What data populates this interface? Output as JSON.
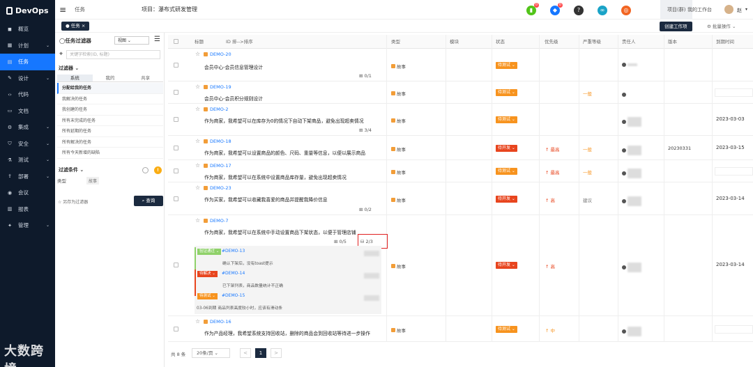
{
  "app": {
    "logo_text": "DevOps"
  },
  "nav": {
    "items": [
      {
        "label": "概览",
        "icon": "dashboard-icon",
        "chev": ""
      },
      {
        "label": "计划",
        "icon": "calendar-icon",
        "chev": "⌄"
      },
      {
        "label": "任务",
        "icon": "task-icon",
        "chev": ""
      },
      {
        "label": "设计",
        "icon": "design-icon",
        "chev": "⌄"
      },
      {
        "label": "代码",
        "icon": "code-icon",
        "chev": ""
      },
      {
        "label": "文档",
        "icon": "document-icon",
        "chev": ""
      },
      {
        "label": "集成",
        "icon": "integration-icon",
        "chev": "⌄"
      },
      {
        "label": "安全",
        "icon": "security-icon",
        "chev": "⌄"
      },
      {
        "label": "测试",
        "icon": "test-icon",
        "chev": "⌄"
      },
      {
        "label": "部署",
        "icon": "deploy-icon",
        "chev": "⌄"
      },
      {
        "label": "会议",
        "icon": "meeting-icon",
        "chev": ""
      },
      {
        "label": "报表",
        "icon": "report-icon",
        "chev": ""
      },
      {
        "label": "管理",
        "icon": "settings-icon",
        "chev": "⌄"
      }
    ],
    "active_index": 2
  },
  "watermark": "大数跨境",
  "topbar": {
    "menu_label": "任务",
    "project_label": "项目：瀑布式研发管理",
    "badge_green": "0",
    "badge_blue": "0",
    "tab_project": "项目(群)",
    "tab_workbench": "我的工作台",
    "user_name": "赵"
  },
  "subbar": {
    "chip_label": "任务",
    "create_label": "创建工作项",
    "batch_label": "批量操作"
  },
  "filter": {
    "title": "任务过滤器",
    "view_label": "视图",
    "search_placeholder": "关键字检索(ID, 标题)",
    "filter_header": "过滤器",
    "tabs": [
      "系统",
      "我的",
      "共享"
    ],
    "list": [
      "分配给我的任务",
      "我解决的任务",
      "我创建的任务",
      "所有未完成的任务",
      "所有延期的任务",
      "所有解决的任务",
      "所有今天新增的缺陷"
    ],
    "cond_label": "过滤条件",
    "type_label": "类型",
    "type_value": "故事",
    "save_label": "另存为过滤器",
    "query_label": "查询"
  },
  "table": {
    "headers": {
      "title": "标题",
      "sort": "ID 排-->排序",
      "type": "类型",
      "module": "模块",
      "status": "状态",
      "priority": "优先级",
      "severity": "严重等级",
      "assignee": "责任人",
      "version": "版本",
      "deadline": "到期时间"
    },
    "rows": [
      {
        "key": "DEMO-20",
        "title": "会员中心-会员信息管理设计",
        "type": "故事",
        "status": "待测试",
        "status_color": "orange",
        "priority": "",
        "severity": "",
        "version": "",
        "date": "",
        "sub": "0/1"
      },
      {
        "key": "DEMO-19",
        "title": "会员中心-会员积分规则设计",
        "type": "故事",
        "status": "待测试",
        "status_color": "orange",
        "priority": "",
        "severity": "一般",
        "version": "",
        "date": ""
      },
      {
        "key": "DEMO-2",
        "title": "作为商家，我希望可以在库存为0的情况下自动下架商品，避免出现超卖情况",
        "type": "故事",
        "status": "待测试",
        "status_color": "orange",
        "priority": "",
        "severity": "",
        "version": "",
        "date": "2023-03-03",
        "sub": "3/4"
      },
      {
        "key": "DEMO-18",
        "title": "作为商家，我希望可以设置商品的颜色、尺码、重量等信息，以便以展示商品",
        "type": "故事",
        "status": "待开发",
        "status_color": "red",
        "priority": "最高",
        "severity": "一般",
        "version": "20230331",
        "date": "2023-03-15"
      },
      {
        "key": "DEMO-17",
        "title": "作为商家，我希望可以在系统中设置商品库存量，避免出现超卖情况",
        "type": "故事",
        "status": "待测试",
        "status_color": "orange",
        "priority": "最高",
        "severity": "一般",
        "version": "",
        "date": ""
      },
      {
        "key": "DEMO-23",
        "title": "作为买家，我希望可以收藏我喜爱的商品并提醒我降价信息",
        "type": "故事",
        "status": "待开发",
        "status_color": "red",
        "priority": "高",
        "severity": "建议",
        "version": "",
        "date": "2023-03-14",
        "sub": "0/2"
      },
      {
        "key": "DEMO-7",
        "title": "作为商家，我希望可以在系统中手动设置商品下架状态，以便于管理店铺",
        "type": "故事",
        "status": "待开发",
        "status_color": "red",
        "priority": "高",
        "severity": "",
        "version": "",
        "date": "2023-03-14",
        "sub_a": "0/5",
        "sub_b": "2/3"
      },
      {
        "key": "DEMO-16",
        "title": "作为产品经理，我希望系统支持回收站，删除的商品会到回收站等待进一步操作",
        "type": "故事",
        "status": "待测试",
        "status_color": "orange",
        "priority": "中",
        "severity": "",
        "version": "",
        "date": ""
      }
    ],
    "subtasks": [
      {
        "status": "验证通过",
        "key": "#DEMO-13",
        "title": "确认下架后，没有toast提示"
      },
      {
        "status": "待解决",
        "key": "#DEMO-14",
        "title": "已下架列表，商品数量统计不正确"
      },
      {
        "status": "待测试",
        "key": "#DEMO-15",
        "title": "03-06到期  商品列表高度较小时，应该有滑动条"
      }
    ]
  },
  "footer": {
    "total": "共 8 条",
    "page_size": "20条/页",
    "prev": "<",
    "current_page": "1",
    "next": ">"
  }
}
